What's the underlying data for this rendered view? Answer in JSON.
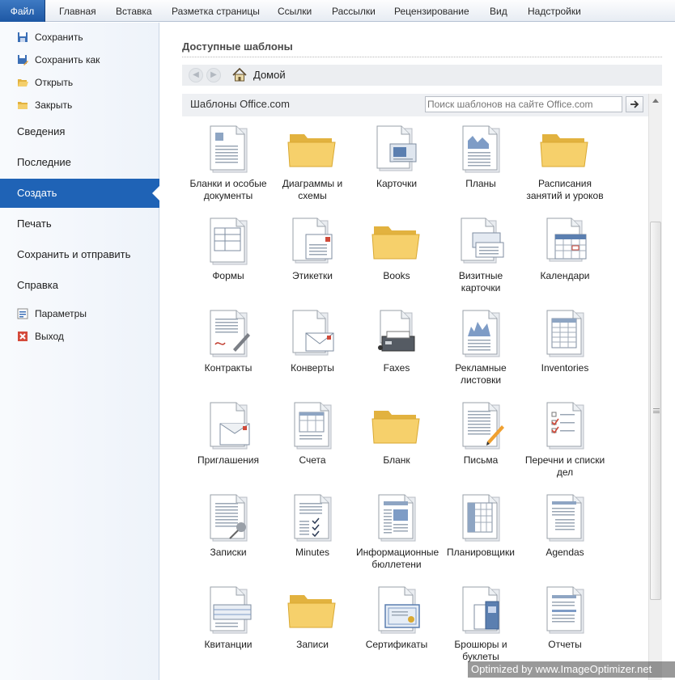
{
  "ribbon": {
    "tabs": [
      "Файл",
      "Главная",
      "Вставка",
      "Разметка страницы",
      "Ссылки",
      "Рассылки",
      "Рецензирование",
      "Вид",
      "Надстройки"
    ]
  },
  "backstage": {
    "commands_top": [
      {
        "label": "Сохранить",
        "icon": "save-icon"
      },
      {
        "label": "Сохранить как",
        "icon": "save-as-icon"
      },
      {
        "label": "Открыть",
        "icon": "open-folder-icon"
      },
      {
        "label": "Закрыть",
        "icon": "close-folder-icon"
      }
    ],
    "tabs": [
      "Сведения",
      "Последние",
      "Создать",
      "Печать",
      "Сохранить и отправить",
      "Справка"
    ],
    "active_tab": "Создать",
    "commands_bottom": [
      {
        "label": "Параметры",
        "icon": "options-icon"
      },
      {
        "label": "Выход",
        "icon": "exit-icon"
      }
    ]
  },
  "main": {
    "heading": "Доступные шаблоны",
    "nav": {
      "back_icon": "back-arrow-icon",
      "forward_icon": "forward-arrow-icon",
      "home_icon": "home-icon",
      "home_label": "Домой"
    },
    "office": {
      "title": "Шаблоны Office.com",
      "search_placeholder": "Поиск шаблонов на сайте Office.com"
    },
    "templates": [
      {
        "label": "Бланки и особые документы",
        "icon": "doc-blank-icon"
      },
      {
        "label": "Диаграммы и схемы",
        "icon": "folder-icon"
      },
      {
        "label": "Карточки",
        "icon": "cards-icon"
      },
      {
        "label": "Планы",
        "icon": "plans-icon"
      },
      {
        "label": "Расписания занятий и уроков",
        "icon": "folder-icon"
      },
      {
        "label": "Формы",
        "icon": "forms-icon"
      },
      {
        "label": "Этикетки",
        "icon": "labels-icon"
      },
      {
        "label": "Books",
        "icon": "folder-icon"
      },
      {
        "label": "Визитные карточки",
        "icon": "business-cards-icon"
      },
      {
        "label": "Календари",
        "icon": "calendar-icon"
      },
      {
        "label": "Контракты",
        "icon": "contract-icon"
      },
      {
        "label": "Конверты",
        "icon": "envelope-icon"
      },
      {
        "label": "Faxes",
        "icon": "fax-icon"
      },
      {
        "label": "Рекламные листовки",
        "icon": "flyer-icon"
      },
      {
        "label": "Inventories",
        "icon": "inventory-icon"
      },
      {
        "label": "Приглашения",
        "icon": "invitation-icon"
      },
      {
        "label": "Счета",
        "icon": "invoice-icon"
      },
      {
        "label": "Бланк",
        "icon": "folder-icon"
      },
      {
        "label": "Письма",
        "icon": "letter-icon"
      },
      {
        "label": "Перечни и списки дел",
        "icon": "checklist-icon"
      },
      {
        "label": "Записки",
        "icon": "memo-icon"
      },
      {
        "label": "Minutes",
        "icon": "minutes-icon"
      },
      {
        "label": "Информационные бюллетени",
        "icon": "newsletter-icon"
      },
      {
        "label": "Планировщики",
        "icon": "planner-icon"
      },
      {
        "label": "Agendas",
        "icon": "agenda-icon"
      },
      {
        "label": "Квитанции",
        "icon": "receipt-icon"
      },
      {
        "label": "Записи",
        "icon": "folder-icon"
      },
      {
        "label": "Сертификаты",
        "icon": "certificate-icon"
      },
      {
        "label": "Брошюры и буклеты",
        "icon": "brochure-icon"
      },
      {
        "label": "Отчеты",
        "icon": "report-icon"
      }
    ]
  },
  "watermark": "Optimized by www.ImageOptimizer.net",
  "colors": {
    "accent": "#1f63b6",
    "folder": "#f2c85b"
  }
}
